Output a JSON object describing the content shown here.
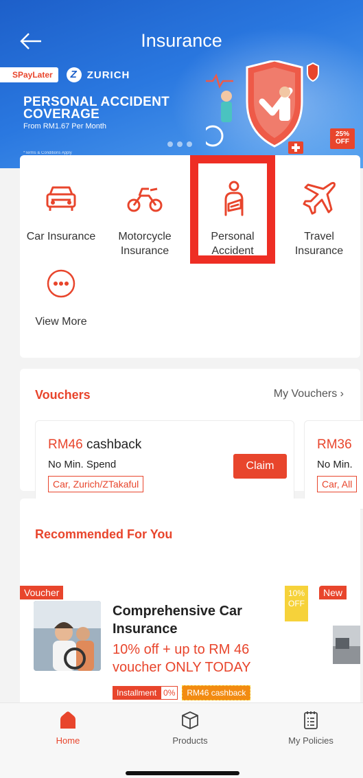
{
  "header": {
    "title": "Insurance"
  },
  "banner": {
    "spaylater": "SPayLater",
    "zurich": "ZURICH",
    "headline_1": "PERSONAL ACCIDENT",
    "headline_2": "COVERAGE",
    "sub": "From RM1.67 Per Month",
    "terms": "*Terms & Conditions Apply",
    "discount": "25%",
    "discount_suffix": "OFF"
  },
  "categories": [
    {
      "label_1": "Car Insurance",
      "label_2": ""
    },
    {
      "label_1": "Motorcycle",
      "label_2": "Insurance"
    },
    {
      "label_1": "Personal",
      "label_2": "Accident"
    },
    {
      "label_1": "Travel",
      "label_2": "Insurance"
    },
    {
      "label_1": "View More",
      "label_2": ""
    }
  ],
  "vouchers": {
    "title": "Vouchers",
    "my_vouchers": "My Vouchers",
    "items": [
      {
        "amount": "RM46",
        "type": "cashback",
        "condition": "No Min. Spend",
        "tag": "Car, Zurich/ZTakaful",
        "claim": "Claim"
      },
      {
        "amount": "RM36",
        "condition": "No Min.",
        "tag": "Car, All"
      }
    ]
  },
  "recommended": {
    "title": "Recommended For You",
    "items": [
      {
        "badge": "Voucher",
        "title": "Comprehensive Car Insurance",
        "offer": "10% off + up to RM 46 voucher ONLY TODAY",
        "off_pct": "10%",
        "off_word": "OFF",
        "tag_installment": "Installment",
        "tag_zero": "0%",
        "tag_cashback": "RM46 cashback"
      },
      {
        "badge": "New"
      }
    ]
  },
  "nav": {
    "home": "Home",
    "products": "Products",
    "policies": "My Policies"
  },
  "colors": {
    "accent": "#e8452c",
    "banner": "#2a78e0",
    "highlight": "#ee2e24"
  }
}
